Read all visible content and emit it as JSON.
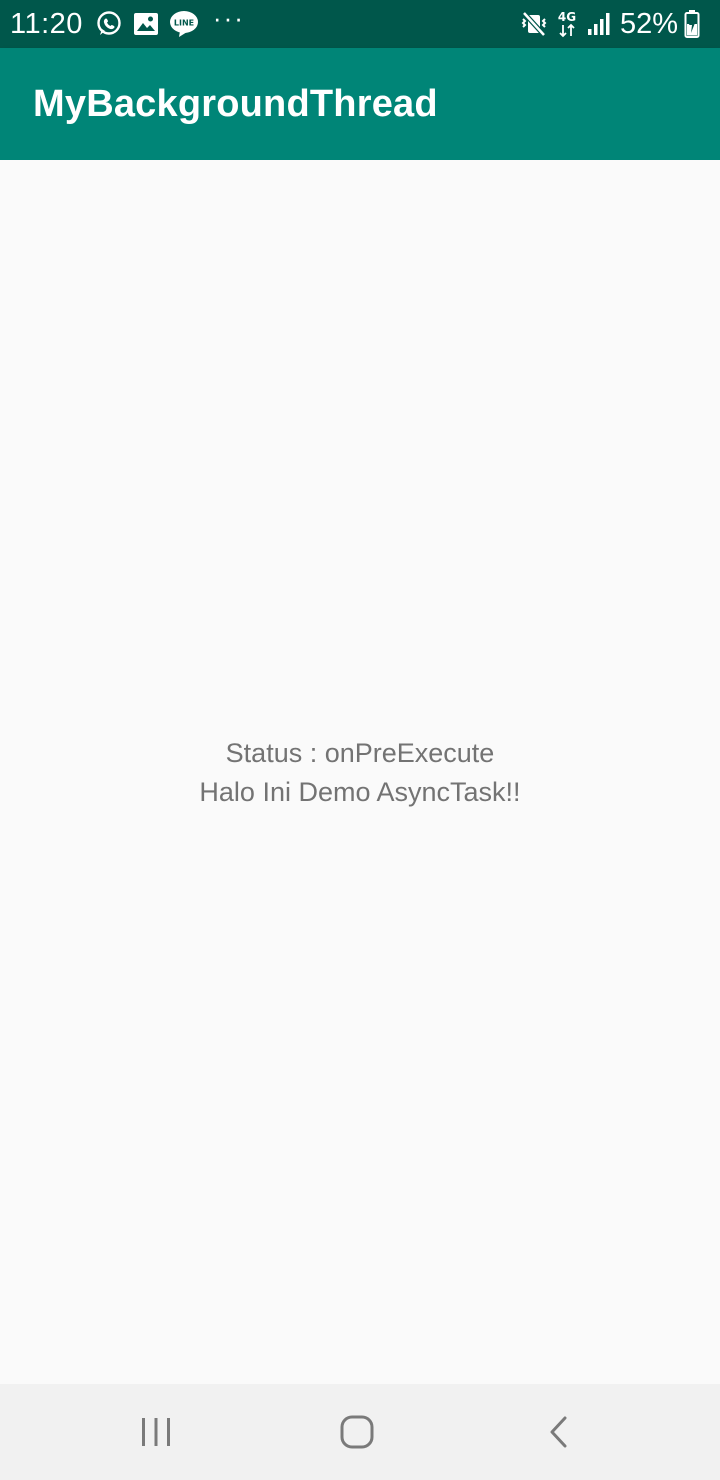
{
  "status_bar": {
    "time": "11:20",
    "left_icons": [
      "whatsapp-icon",
      "gallery-icon",
      "line-icon"
    ],
    "more_indicator": "···",
    "network_type": "4G",
    "battery_level": "52%",
    "right_icons": [
      "mute-vibrate-icon",
      "network-4g-icon",
      "signal-icon",
      "battery-charging-icon"
    ]
  },
  "app_bar": {
    "title": "MyBackgroundThread"
  },
  "main": {
    "status_line": "Status : onPreExecute",
    "message_line": "Halo Ini Demo AsyncTask!!"
  },
  "nav_bar": {
    "buttons": [
      "recent-apps-icon",
      "home-icon",
      "back-icon"
    ]
  },
  "colors": {
    "status_bar": "#00574b",
    "app_bar": "#008577",
    "background": "#fafafa",
    "body_text": "#737373",
    "nav_bar": "#f1f1f1",
    "nav_icons": "#7a7a7a"
  }
}
